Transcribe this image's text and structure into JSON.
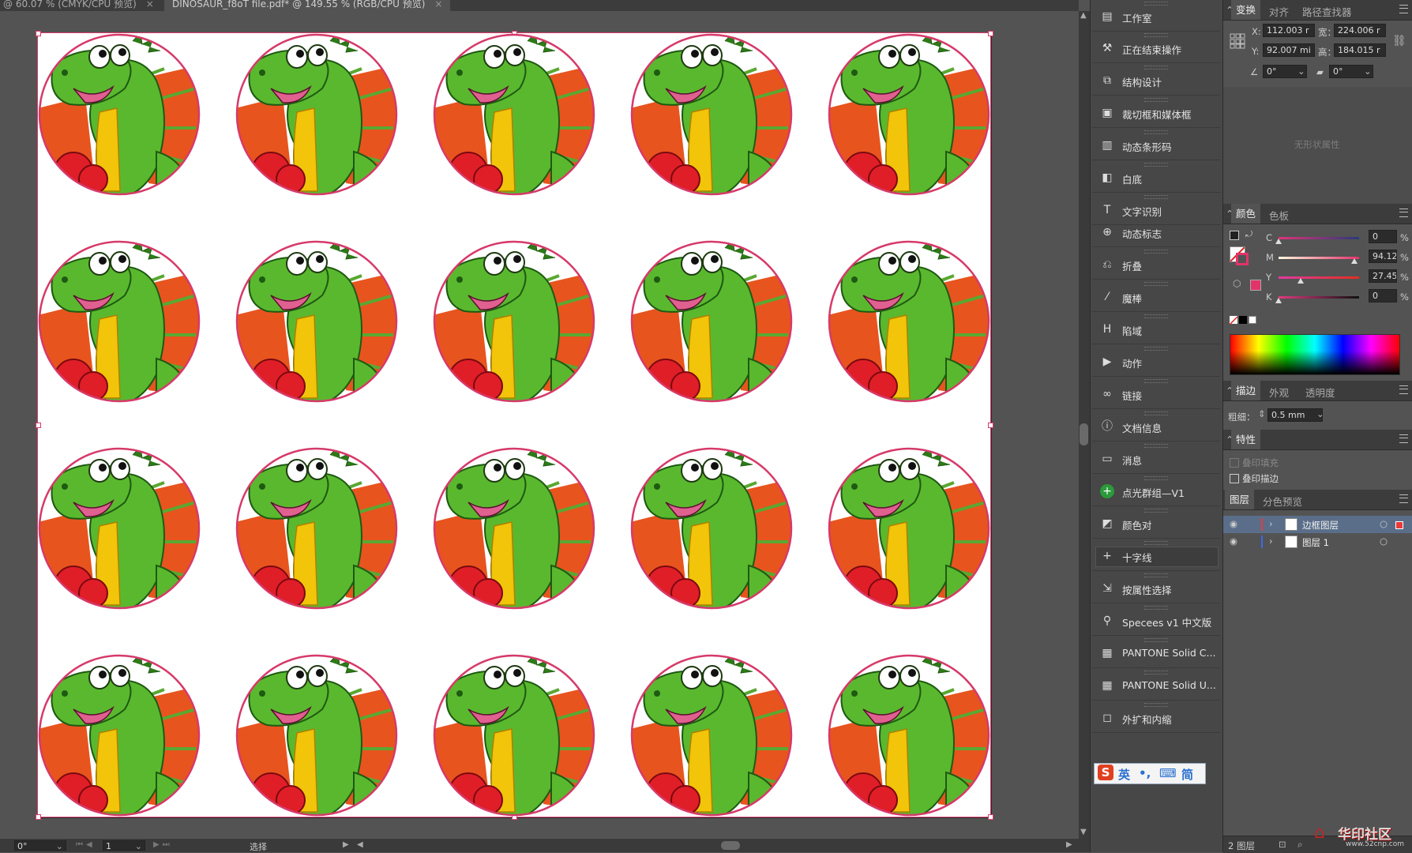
{
  "tabs": [
    {
      "label": "@ 60.07 % (CMYK/CPU 预览)",
      "close": "×"
    },
    {
      "label": "DINOSAUR_f8oT file.pdf* @ 149.55 % (RGB/CPU 预览)",
      "close": "×"
    }
  ],
  "status": {
    "rotation": "0°",
    "page": "1",
    "mode": "选择"
  },
  "tools_panel": {
    "items": [
      {
        "label": "工作室",
        "icon": "studio-icon"
      },
      {
        "label": "正在结束操作",
        "icon": "finish-icon"
      },
      {
        "label": "结构设计",
        "icon": "structure-icon"
      },
      {
        "label": "裁切框和媒体框",
        "icon": "crop-box-icon"
      },
      {
        "label": "动态条形码",
        "icon": "barcode-icon"
      },
      {
        "label": "白底",
        "icon": "white-base-icon"
      },
      {
        "label": "文字识别",
        "icon": "text-recognition-icon"
      },
      {
        "label": "动态标志",
        "icon": "dynamic-mark-icon"
      },
      {
        "label": "折叠",
        "icon": "fold-icon"
      },
      {
        "label": "魔棒",
        "icon": "magic-wand-icon"
      },
      {
        "label": "陷域",
        "icon": "trap-icon"
      },
      {
        "label": "动作",
        "icon": "action-icon"
      },
      {
        "label": "链接",
        "icon": "link-icon"
      },
      {
        "label": "文档信息",
        "icon": "document-info-icon"
      },
      {
        "label": "消息",
        "icon": "message-icon"
      },
      {
        "label": "点光群组—V1",
        "icon": "spot-group-icon"
      },
      {
        "label": "颜色对",
        "icon": "color-pair-icon"
      },
      {
        "label": "十字线",
        "icon": "crosshair-icon"
      },
      {
        "label": "按属性选择",
        "icon": "select-by-attr-icon"
      },
      {
        "label": "Specees v1 中文版",
        "icon": "specees-icon"
      },
      {
        "label": "PANTONE Solid C...",
        "icon": "pantone-folder-icon"
      },
      {
        "label": "PANTONE Solid U...",
        "icon": "pantone-folder-icon"
      },
      {
        "label": "外扩和内缩",
        "icon": "expand-shrink-icon"
      }
    ],
    "ime": {
      "logo": "S",
      "lang": "英",
      "punct": "•,",
      "keyboard": "⌨",
      "mode": "简"
    }
  },
  "transform": {
    "tabs": [
      "变换",
      "对齐",
      "路径查找器"
    ],
    "x": "112.003 r",
    "w": "224.006 r",
    "y": "92.007 mi",
    "h": "184.015 r",
    "x_label": "X:",
    "w_label": "宽：",
    "y_label": "Y:",
    "h_label": "高：",
    "rotate": "0°",
    "shear": "0°",
    "no_shape": "无形状属性"
  },
  "color": {
    "tabs": [
      "颜色",
      "色板"
    ],
    "channels": [
      {
        "name": "C",
        "value": "0",
        "fraction": 0.0
      },
      {
        "name": "M",
        "value": "94.12",
        "fraction": 0.9412
      },
      {
        "name": "Y",
        "value": "27.45",
        "fraction": 0.2745
      },
      {
        "name": "K",
        "value": "0",
        "fraction": 0.0
      }
    ],
    "unit": "%",
    "swatch_color": "#e2336a"
  },
  "stroke": {
    "tabs": [
      "描边",
      "外观",
      "透明度"
    ],
    "weight_label": "粗细：",
    "weight": "0.5 mm"
  },
  "attributes": {
    "tab": "特性",
    "overprint_fill": "叠印填充",
    "overprint_stroke": "叠印描边"
  },
  "layers": {
    "tabs": [
      "图层",
      "分色预览"
    ],
    "rows": [
      {
        "name": "边框图层",
        "color": "#e83a3a"
      },
      {
        "name": "图层 1",
        "color": "#3a6ae8"
      }
    ],
    "footer": "2 图层"
  },
  "watermark": {
    "text": "华印社区",
    "url": "www.52cnp.com"
  },
  "artwork": {
    "rows": 4,
    "cols": 5,
    "stroke_color": "#d63a6a"
  }
}
